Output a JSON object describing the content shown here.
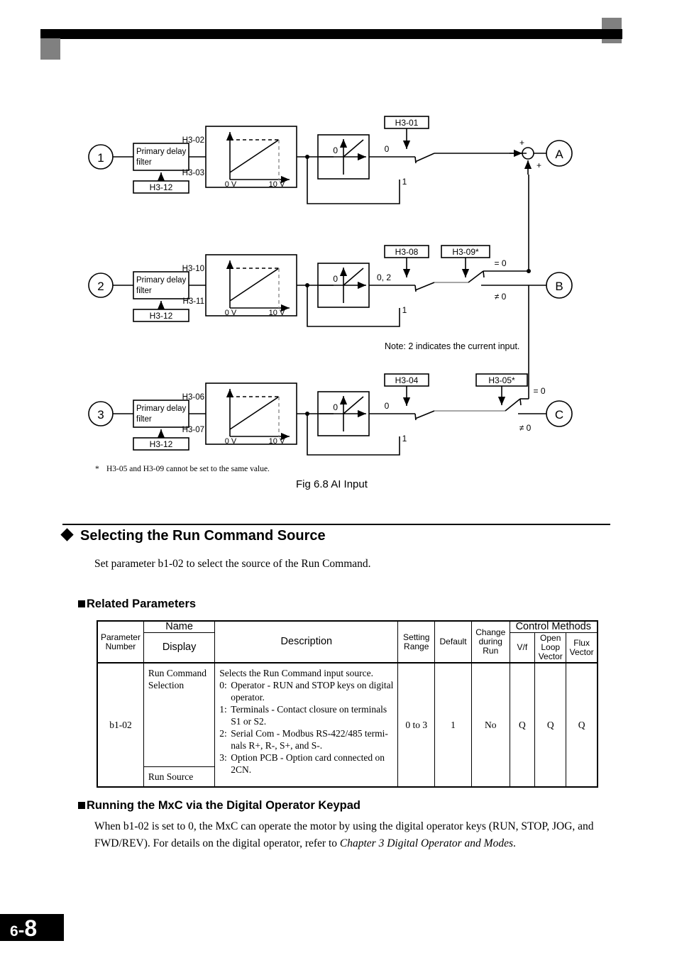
{
  "page": {
    "footer_chapter": "6",
    "footer_dash": "-",
    "footer_page": "8"
  },
  "figure": {
    "caption": "Fig 6.8  AI Input",
    "footnote_marker": "*",
    "footnote": "H3-05 and H3-09 cannot be set to the same value.",
    "note": "Note: 2 indicates the current input.",
    "channels": [
      {
        "input_label": "1",
        "filter_label_line1": "Primary delay",
        "filter_label_line2": "filter",
        "filter_param": "H3-12",
        "graph_top_label": "H3-02",
        "graph_bottom_label": "H3-03",
        "graph_x_min": "0 V",
        "graph_x_max": "10 V",
        "gain_zero": "0",
        "switch_top_label": "0",
        "switch_bottom_label": "1",
        "select_param": "H3-01",
        "output_label": "A"
      },
      {
        "input_label": "2",
        "filter_label_line1": "Primary delay",
        "filter_label_line2": "filter",
        "filter_param": "H3-12",
        "graph_top_label": "H3-10",
        "graph_bottom_label": "H3-11",
        "graph_x_min": "0 V",
        "graph_x_max": "10 V",
        "gain_zero": "0",
        "switch_top_label": "0, 2",
        "switch_bottom_label": "1",
        "select_param": "H3-08",
        "route_param": "H3-09*",
        "route_eq_label": "= 0",
        "route_neq_label": "≠ 0",
        "output_label": "B"
      },
      {
        "input_label": "3",
        "filter_label_line1": "Primary delay",
        "filter_label_line2": "filter",
        "filter_param": "H3-12",
        "graph_top_label": "H3-06",
        "graph_bottom_label": "H3-07",
        "graph_x_min": "0 V",
        "graph_x_max": "10 V",
        "gain_zero": "0",
        "switch_top_label": "0",
        "switch_bottom_label": "1",
        "select_param": "H3-04",
        "route_param": "H3-05*",
        "route_eq_label": "= 0",
        "route_neq_label": "≠ 0",
        "output_label": "C"
      }
    ],
    "summing_plus_1": "+",
    "summing_plus_2": "+"
  },
  "section": {
    "title": "Selecting the Run Command Source",
    "intro": "Set parameter b1-02 to select the source of the Run Command."
  },
  "related_parameters": {
    "heading": "Related Parameters",
    "table": {
      "headers": {
        "parameter_number": "Parameter\nNumber",
        "name": "Name",
        "display": "Display",
        "description": "Description",
        "setting_range": "Setting\nRange",
        "default": "Default",
        "change_during_run": "Change\nduring\nRun",
        "control_methods": "Control Methods",
        "vf": "V/f",
        "open_loop_vector": "Open\nLoop\nVector",
        "flux_vector": "Flux\nVector"
      },
      "header_lines": {
        "parameter_number": [
          "Parameter",
          "Number"
        ],
        "setting_range": [
          "Setting",
          "Range"
        ],
        "change_during_run": [
          "Change",
          "during",
          "Run"
        ],
        "open_loop_vector": [
          "Open",
          "Loop",
          "Vector"
        ],
        "flux_vector": [
          "Flux",
          "Vector"
        ]
      },
      "rows": [
        {
          "parameter_number": "b1-02",
          "name": "Run Command\nSelection",
          "name_lines": [
            "Run Command",
            "Selection"
          ],
          "display": "Run Source",
          "description_intro": "Selects the Run Command input source.",
          "description_items": [
            {
              "num": "0:",
              "lines": [
                "Operator - RUN and STOP keys on digital",
                "operator."
              ]
            },
            {
              "num": "1:",
              "lines": [
                "Terminals - Contact closure on terminals",
                "S1 or S2."
              ]
            },
            {
              "num": "2:",
              "lines": [
                "Serial Com - Modbus RS-422/485 termi-",
                "nals R+, R-, S+, and S-."
              ]
            },
            {
              "num": "3:",
              "lines": [
                "Option PCB - Option card connected on",
                "2CN."
              ]
            }
          ],
          "setting_range": "0 to 3",
          "default": "1",
          "change_during_run": "No",
          "vf": "Q",
          "open_loop_vector": "Q",
          "flux_vector": "Q"
        }
      ]
    }
  },
  "running_section": {
    "heading": "Running the MxC via the Digital Operator Keypad",
    "paragraph_part1": "When b1-02 is set to 0, the MxC can operate the motor by using the digital operator keys (RUN, STOP, JOG, and FWD/REV). For details on the digital operator, refer to ",
    "paragraph_italic": "Chapter 3 Digital Operator and Modes",
    "paragraph_part2": "."
  }
}
